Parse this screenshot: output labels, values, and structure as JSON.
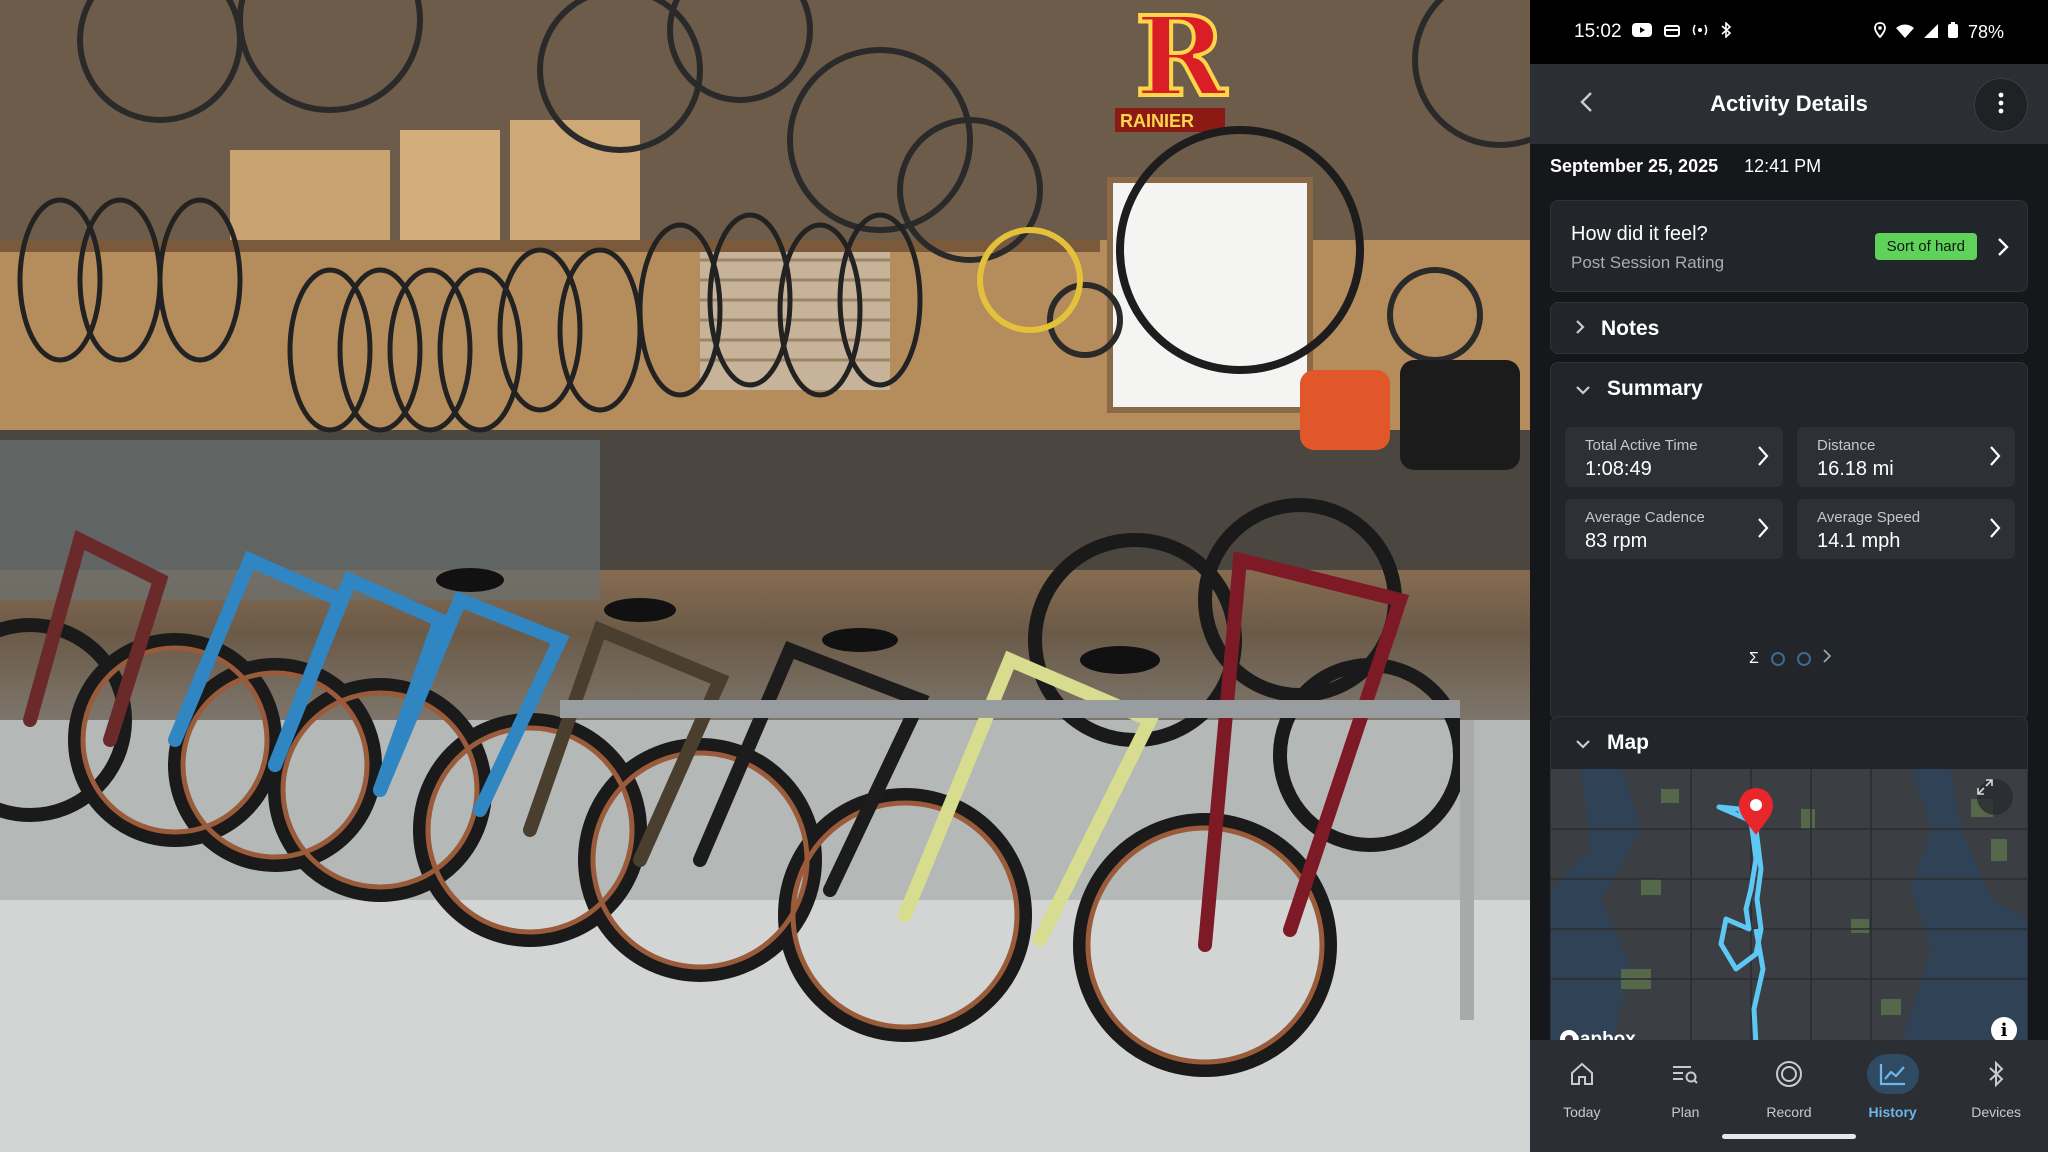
{
  "status_bar": {
    "time": "15:02",
    "battery": "78%",
    "icons": [
      "youtube-icon",
      "card-icon",
      "nfc-icon",
      "bluetooth-icon",
      "location-icon",
      "wifi-icon",
      "signal-icon",
      "battery-icon"
    ]
  },
  "app_bar": {
    "title": "Activity Details"
  },
  "activity": {
    "date": "September 25, 2025",
    "time": "12:41 PM"
  },
  "feel_card": {
    "title": "How did it feel?",
    "subtitle": "Post Session Rating",
    "rating": "Sort of hard"
  },
  "notes": {
    "label": "Notes"
  },
  "summary": {
    "label": "Summary",
    "tiles": [
      {
        "label": "Total Active Time",
        "value": "1:08:49"
      },
      {
        "label": "Distance",
        "value": "16.18 mi"
      },
      {
        "label": "Average Cadence",
        "value": "83 rpm"
      },
      {
        "label": "Average Speed",
        "value": "14.1 mph"
      }
    ],
    "pager_symbol": "Σ"
  },
  "map": {
    "label": "Map",
    "attribution": "mapbox",
    "info": "i"
  },
  "bottom_nav": [
    {
      "label": "Today",
      "icon": "home-icon"
    },
    {
      "label": "Plan",
      "icon": "plan-icon"
    },
    {
      "label": "Record",
      "icon": "record-icon"
    },
    {
      "label": "History",
      "icon": "history-icon",
      "active": true
    },
    {
      "label": "Devices",
      "icon": "bluetooth-icon"
    }
  ],
  "photo": {
    "sign_text": "RAINIER"
  },
  "colors": {
    "accent": "#6cb6ea",
    "rating_badge": "#5fd25a",
    "panel_bg": "#15171a",
    "route": "#5ec8f5",
    "pin": "#e8262c"
  }
}
